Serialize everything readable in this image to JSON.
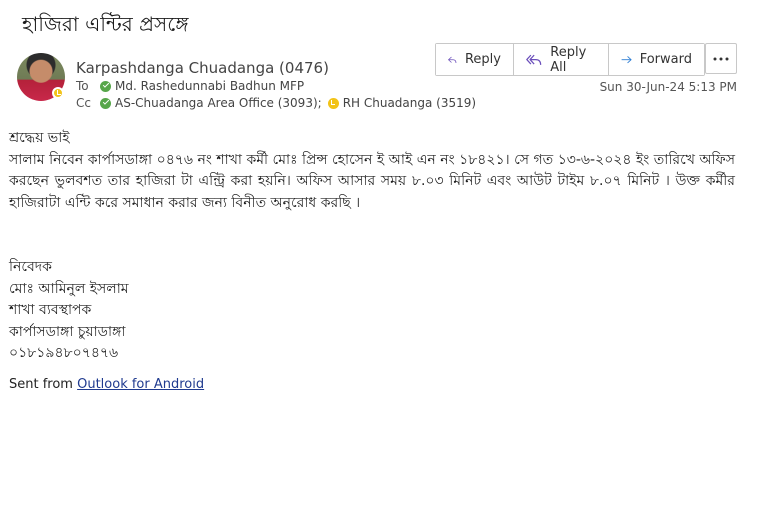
{
  "email": {
    "subject": "হাজিরা এন্টির প্রসঙ্গে",
    "sender": "Karpashdanga Chuadanga (0476)",
    "to_label": "To",
    "to": [
      "Md. Rashedunnabi Badhun MFP"
    ],
    "cc_label": "Cc",
    "cc": [
      "AS-Chuadanga Area Office (3093);",
      "RH Chuadanga (3519)"
    ],
    "date": "Sun 30-Jun-24 5:13 PM"
  },
  "actions": {
    "reply": "Reply",
    "reply_all": "Reply All",
    "forward": "Forward",
    "more_icon": "ellipsis-icon"
  },
  "body": {
    "greeting": "শ্রদ্ধেয় ভাই",
    "paragraph": "সালাম নিবেন কার্পাসডাঙ্গা ০৪৭৬ নং শাখা কর্মী মোঃ প্রিন্স হোসেন ই আই এন নং ১৮৪২১। সে গত ১৩-৬-২০২৪ ইং তারিখে অফিস করছেন ভুলবশত তার হাজিরা টা এন্ট্রি করা হয়নি। অফিস আসার সময় ৮.০৩ মিনিট এবং আউট টাইম ৮.০৭ মিনিট । উক্ত কর্মীর হাজিরাটা এন্টি করে সমাধান করার জন্য বিনীত অনুরোধ করছি ।",
    "closing": "নিবেদক",
    "sig_name": "মোঃ আমিনুল ইসলাম",
    "sig_title": "শাখা ব্যবস্থাপক",
    "sig_branch": "কার্পাসডাঙ্গা চুয়াডাঙ্গা",
    "sig_phone": "০১৮১৯৪৮০৭৪৭৬"
  },
  "footer": {
    "sent_from": "Sent from ",
    "link_text": "Outlook for Android"
  },
  "colors": {
    "accent": "#6b4fbb",
    "forward_blue": "#2b7cd3",
    "presence_available": "#57a64a",
    "presence_away": "#f2c318",
    "link": "#1f3a8f"
  }
}
